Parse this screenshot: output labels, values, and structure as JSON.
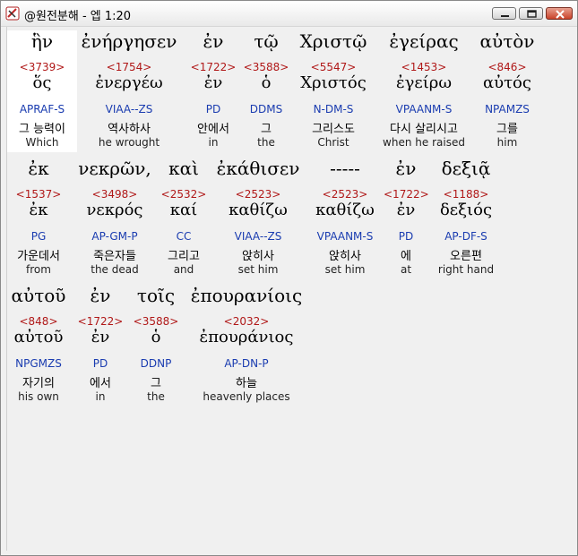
{
  "window": {
    "title": "@원전분해 - 엡 1:20"
  },
  "rows": [
    {
      "words": [
        {
          "greek": "ἣν",
          "num": "<3739>",
          "lemma": "ὅς",
          "parse": "APRAF-S",
          "kor": "그 능력이",
          "eng": "Which"
        },
        {
          "greek": "ἐνήργησεν",
          "num": "<1754>",
          "lemma": "ἐνεργέω",
          "parse": "VIAA--ZS",
          "kor": "역사하사",
          "eng": "he wrought"
        },
        {
          "greek": "ἐν",
          "num": "<1722>",
          "lemma": "ἐν",
          "parse": "PD",
          "kor": "안에서",
          "eng": "in"
        },
        {
          "greek": "τῷ",
          "num": "<3588>",
          "lemma": "ὁ",
          "parse": "DDMS",
          "kor": "그",
          "eng": "the"
        },
        {
          "greek": "Χριστῷ",
          "num": "<5547>",
          "lemma": "Χριστός",
          "parse": "N-DM-S",
          "kor": "그리스도",
          "eng": "Christ"
        },
        {
          "greek": "ἐγείρας",
          "num": "<1453>",
          "lemma": "ἐγείρω",
          "parse": "VPAANM-S",
          "kor": "다시 살리시고",
          "eng": "when he raised"
        },
        {
          "greek": "αὐτὸν",
          "num": "<846>",
          "lemma": "αὐτός",
          "parse": "NPAMZS",
          "kor": "그를",
          "eng": "him"
        }
      ]
    },
    {
      "words": [
        {
          "greek": "ἐκ",
          "num": "<1537>",
          "lemma": "ἐκ",
          "parse": "PG",
          "kor": "가운데서",
          "eng": "from"
        },
        {
          "greek": "νεκρῶν,",
          "num": "<3498>",
          "lemma": "νεκρός",
          "parse": "AP-GM-P",
          "kor": "죽은자들",
          "eng": "the dead"
        },
        {
          "greek": "καὶ",
          "num": "<2532>",
          "lemma": "καί",
          "parse": "CC",
          "kor": "그리고",
          "eng": "and"
        },
        {
          "greek": "ἐκάθισεν",
          "num": "<2523>",
          "lemma": "καθίζω",
          "parse": "VIAA--ZS",
          "kor": "앉히사",
          "eng": "set him"
        },
        {
          "greek": "-----",
          "num": "<2523>",
          "lemma": "καθίζω",
          "parse": "VPAANM-S",
          "kor": "앉히사",
          "eng": "set him"
        },
        {
          "greek": "ἐν",
          "num": "<1722>",
          "lemma": "ἐν",
          "parse": "PD",
          "kor": "에",
          "eng": "at"
        },
        {
          "greek": "δεξιᾷ",
          "num": "<1188>",
          "lemma": "δεξιός",
          "parse": "AP-DF-S",
          "kor": "오른편",
          "eng": "right hand"
        }
      ]
    },
    {
      "words": [
        {
          "greek": "αὐτοῦ",
          "num": "<848>",
          "lemma": "αὐτοῦ",
          "parse": "NPGMZS",
          "kor": "자기의",
          "eng": "his own"
        },
        {
          "greek": "ἐν",
          "num": "<1722>",
          "lemma": "ἐν",
          "parse": "PD",
          "kor": "에서",
          "eng": "in"
        },
        {
          "greek": "τοῖς",
          "num": "<3588>",
          "lemma": "ὁ",
          "parse": "DDNP",
          "kor": "그",
          "eng": "the"
        },
        {
          "greek": "ἐπουρανίοις",
          "num": "<2032>",
          "lemma": "ἐπουράνιος",
          "parse": "AP-DN-P",
          "kor": "하늘",
          "eng": "heavenly places"
        }
      ]
    }
  ]
}
